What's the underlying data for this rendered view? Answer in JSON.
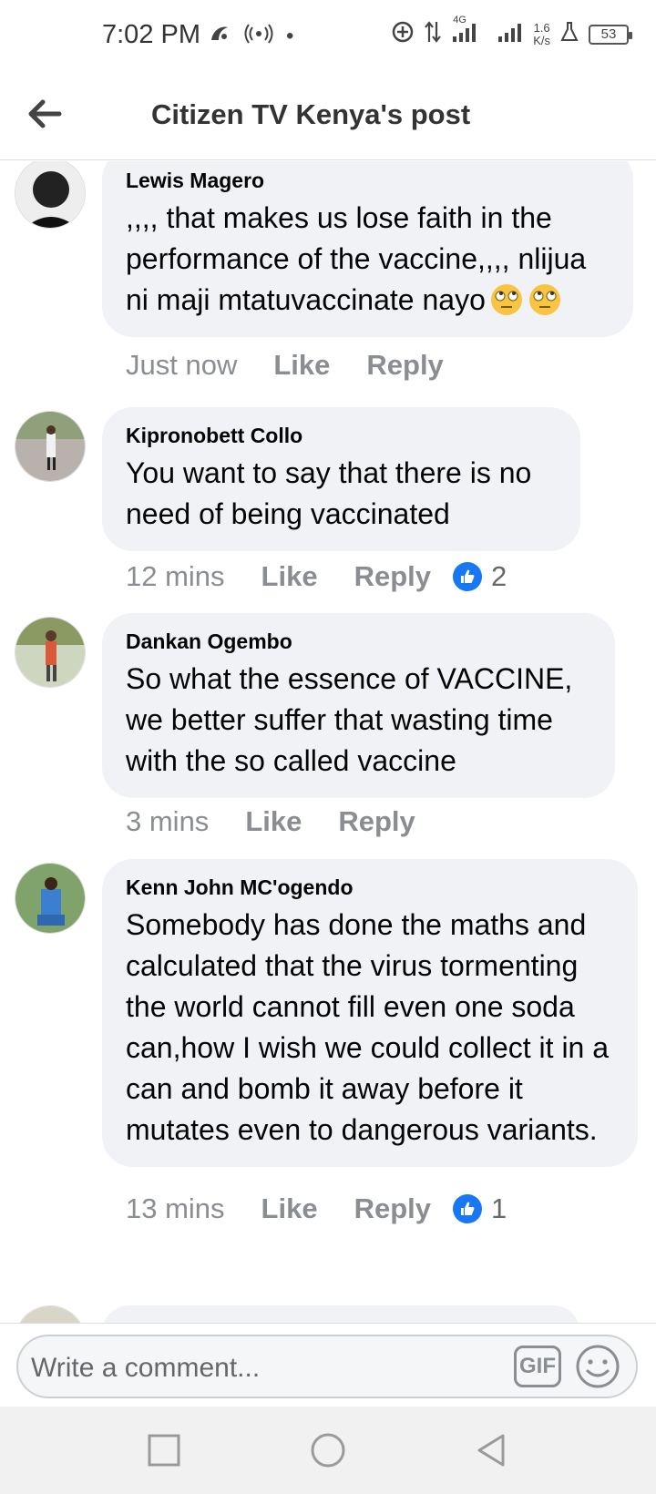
{
  "status_bar": {
    "time": "7:02 PM",
    "dot": "•",
    "net_speed_value": "1.6",
    "net_speed_unit": "K/s",
    "network_label": "4G",
    "battery": "53"
  },
  "header": {
    "title": "Citizen TV Kenya's post"
  },
  "comments": [
    {
      "author": "Lewis Magero",
      "text": ",,,, that makes us lose faith in the performance of the vaccine,,,, nlijua ni maji mtatuvaccinate nayo",
      "time": "Just now",
      "like_label": "Like",
      "reply_label": "Reply",
      "like_count": ""
    },
    {
      "author": "Kipronobett Collo",
      "text": "You want to say that there is no need of being vaccinated",
      "time": "12 mins",
      "like_label": "Like",
      "reply_label": "Reply",
      "like_count": "2"
    },
    {
      "author": "Dankan Ogembo",
      "text": "So what the essence of VACCINE, we better suffer that wasting time with the so called vaccine",
      "time": "3 mins",
      "like_label": "Like",
      "reply_label": "Reply",
      "like_count": ""
    },
    {
      "author": "Kenn John MC'ogendo",
      "text": "Somebody has done the maths and calculated that the virus tormenting the world cannot fill even one soda can,how I wish we could collect it in a can and bomb it away before it mutates even to dangerous variants.",
      "time": "13 mins",
      "like_label": "Like",
      "reply_label": "Reply",
      "like_count": "1"
    }
  ],
  "composer": {
    "placeholder": "Write a comment...",
    "gif_label": "GIF"
  },
  "colors": {
    "bubble": "#f0f2f5",
    "like_blue": "#1877f2",
    "meta_gray": "#8a8d91"
  }
}
